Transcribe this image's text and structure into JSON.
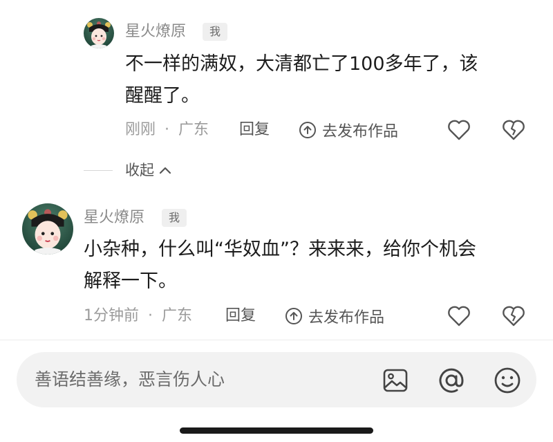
{
  "comments": [
    {
      "username": "星火燎原",
      "badge": "我",
      "text_lines": [
        "不一样的满奴，大清都亡了100多年了，该",
        "醒醒了。"
      ],
      "time": "刚刚",
      "separator": "·",
      "location": "广东",
      "reply_label": "回复",
      "post_work_label": "去发布作品",
      "avatar_icon": "avatar-portrait"
    },
    {
      "username": "星火燎原",
      "badge": "我",
      "text_lines": [
        "小杂种，什么叫“华奴血”？来来来，给你个机会",
        "解释一下。"
      ],
      "time": "1分钟前",
      "separator": "·",
      "location": "广东",
      "reply_label": "回复",
      "post_work_label": "去发布作品",
      "avatar_icon": "avatar-portrait"
    }
  ],
  "collapse_label": "收起",
  "input": {
    "placeholder": "善语结善缘，恶言伤人心",
    "icons": [
      "image-icon",
      "at-icon",
      "emoji-icon"
    ]
  },
  "colors": {
    "icon_gray": "#555555",
    "meta_gray": "#9b9b9b",
    "input_bg": "#f2f2f2"
  }
}
